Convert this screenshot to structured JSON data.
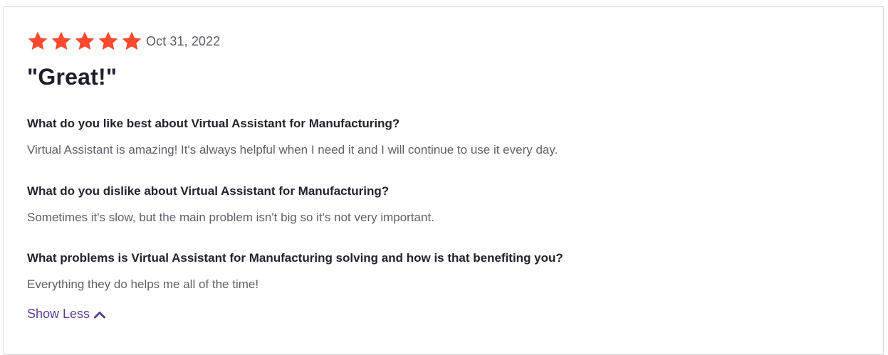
{
  "review": {
    "rating": 5,
    "max_rating": 5,
    "star_color": "#ff492c",
    "date": "Oct 31, 2022",
    "title": "\"Great!\"",
    "sections": [
      {
        "question": "What do you like best about Virtual Assistant for Manufacturing?",
        "answer": "Virtual Assistant is amazing! It's always helpful when I need it and I will continue to use it every day."
      },
      {
        "question": "What do you dislike about Virtual Assistant for Manufacturing?",
        "answer": "Sometimes it's slow, but the main problem isn't big so it's not very important."
      },
      {
        "question": "What problems is Virtual Assistant for Manufacturing solving and how is that benefiting you?",
        "answer": "Everything they do helps me all of the time!"
      }
    ],
    "toggle_label": "Show Less",
    "toggle_icon": "chevron-up-icon",
    "link_color": "#5a3e94"
  }
}
